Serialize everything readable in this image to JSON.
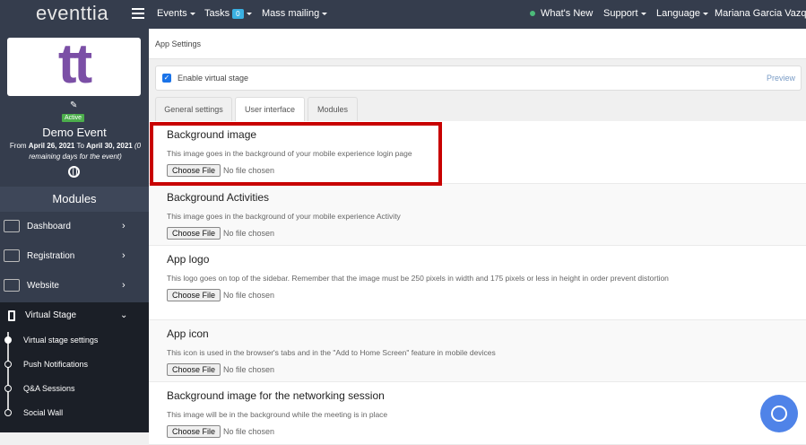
{
  "topbar": {
    "brand": "eventtia",
    "events": "Events",
    "tasks": "Tasks",
    "tasks_count": "0",
    "mass_mailing": "Mass mailing",
    "whats_new": "What's New",
    "support": "Support",
    "language": "Language",
    "user": "Mariana Garcia Vazquez"
  },
  "sidebar": {
    "logo_text": "tt",
    "status": "Active",
    "event_name": "Demo Event",
    "dates_from": "From",
    "date_start": "April 26, 2021",
    "dates_to": "To",
    "date_end": "April 30, 2021",
    "remaining": "(0 remaining days for the event)",
    "modules_title": "Modules",
    "items": [
      {
        "label": "Dashboard"
      },
      {
        "label": "Registration"
      },
      {
        "label": "Website"
      }
    ],
    "virtual_stage": {
      "label": "Virtual Stage",
      "subitems": [
        "Virtual stage settings",
        "Push Notifications",
        "Q&A Sessions",
        "Social Wall"
      ]
    }
  },
  "main": {
    "breadcrumb": "App Settings",
    "enable_label": "Enable virtual stage",
    "enable_checked": true,
    "preview": "Preview",
    "tabs": [
      "General settings",
      "User interface",
      "Modules"
    ],
    "active_tab": "User interface",
    "file_button": "Choose File",
    "no_file": "No file chosen",
    "rows": [
      {
        "title": "Background image",
        "desc": "This image goes in the background of your mobile experience login page"
      },
      {
        "title": "Background Activities",
        "desc": "This image goes in the background of your mobile experience Activity"
      },
      {
        "title": "App logo",
        "desc": "This logo goes on top of the sidebar. Remember that the image must be 250 pixels in width and 175 pixels or less in height in order prevent distortion"
      },
      {
        "title": "App icon",
        "desc": "This icon is used in the browser's tabs and in the \"Add to Home Screen\" feature in mobile devices"
      },
      {
        "title": "Background image for the networking session",
        "desc": "This image will be in the background while the meeting is in place"
      }
    ]
  },
  "colors": {
    "topbar": "#353d4d",
    "highlight": "#c80000",
    "logo": "#7b4fa6",
    "chat": "#4f83e8"
  }
}
